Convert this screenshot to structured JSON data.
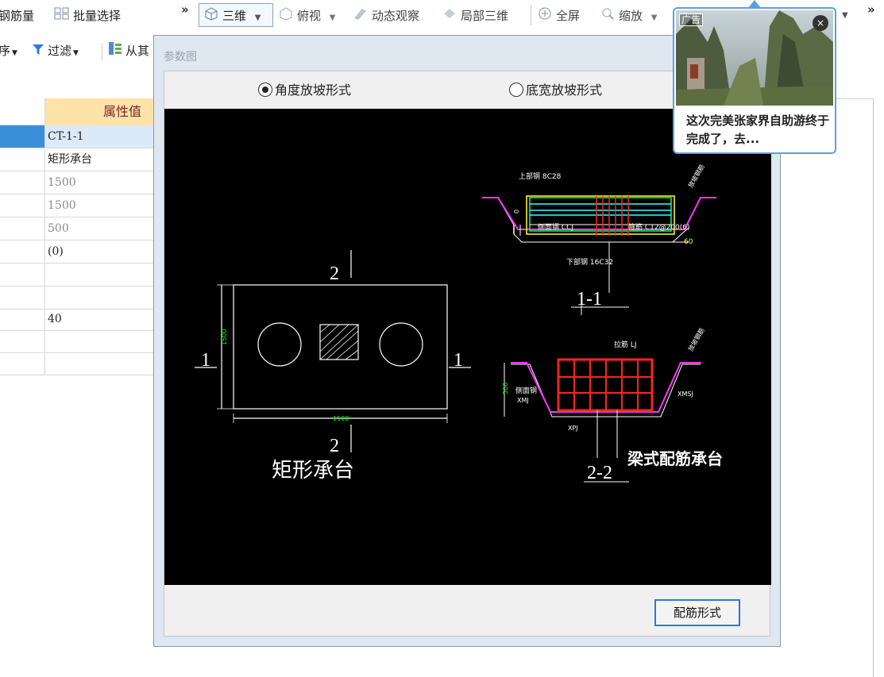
{
  "toolbar": {
    "item_rebar_amount": "钢筋量",
    "item_batch_select": "批量选择",
    "overflow1": "»",
    "view_3d": "三维",
    "view_top": "俯视",
    "orbit": "动态观察",
    "local_3d": "局部三维",
    "fullscreen": "全屏",
    "zoom": "缩放",
    "overflow2": "»"
  },
  "toolbar2": {
    "sort": "序",
    "filter": "过滤",
    "from": "从其"
  },
  "property_grid": {
    "header_value": "属性值",
    "rows": [
      {
        "value": "CT-1-1",
        "grey": false
      },
      {
        "value": "矩形承台",
        "grey": false
      },
      {
        "value": "1500",
        "grey": true
      },
      {
        "value": "1500",
        "grey": true
      },
      {
        "value": "500",
        "grey": true
      },
      {
        "value": "(0)",
        "grey": false
      },
      {
        "value": "",
        "grey": false
      },
      {
        "value": "",
        "grey": false
      },
      {
        "value": "40",
        "grey": false
      },
      {
        "value": "",
        "grey": false
      },
      {
        "value": "",
        "grey": false
      }
    ]
  },
  "dialog": {
    "title": "参数图",
    "radio_angle": "角度放坡形式",
    "radio_bottom": "底宽放坡形式",
    "button_config": "配筋形式"
  },
  "drawing": {
    "label_rect": "矩形承台",
    "label_beam": "梁式配筋承台",
    "sec_1": "1",
    "sec_2": "2",
    "sec_11": "1-1",
    "sec_22": "2-2",
    "dim_1500_v": "1500",
    "dim_1500_h": "1500",
    "top_bar": "上部钢 8C28",
    "side_bar": "侧面钢 CCJ",
    "stirrup": "箍筋 C12@200(6)",
    "bottom_bar": "下部钢 16C32",
    "tie_bar": "拉筋 LJ",
    "side_bar2": "侧面钢",
    "xmj": "XMJ",
    "xmsj": "XMSJ",
    "xpj": "XPJ",
    "dim_500": "500",
    "angle_60": "60",
    "zero": "0",
    "slope1": "放坡钢筋",
    "slope2": "放坡钢筋"
  },
  "ad": {
    "tag": "广告",
    "close": "×",
    "text": "这次完美张家界自助游终于完成了，去..."
  },
  "colors": {
    "selected_row": "#3b8fd9",
    "header_bg": "#fde3a7",
    "dialog_bg": "#dfe7f1",
    "accent_blue": "#2f78d0"
  }
}
